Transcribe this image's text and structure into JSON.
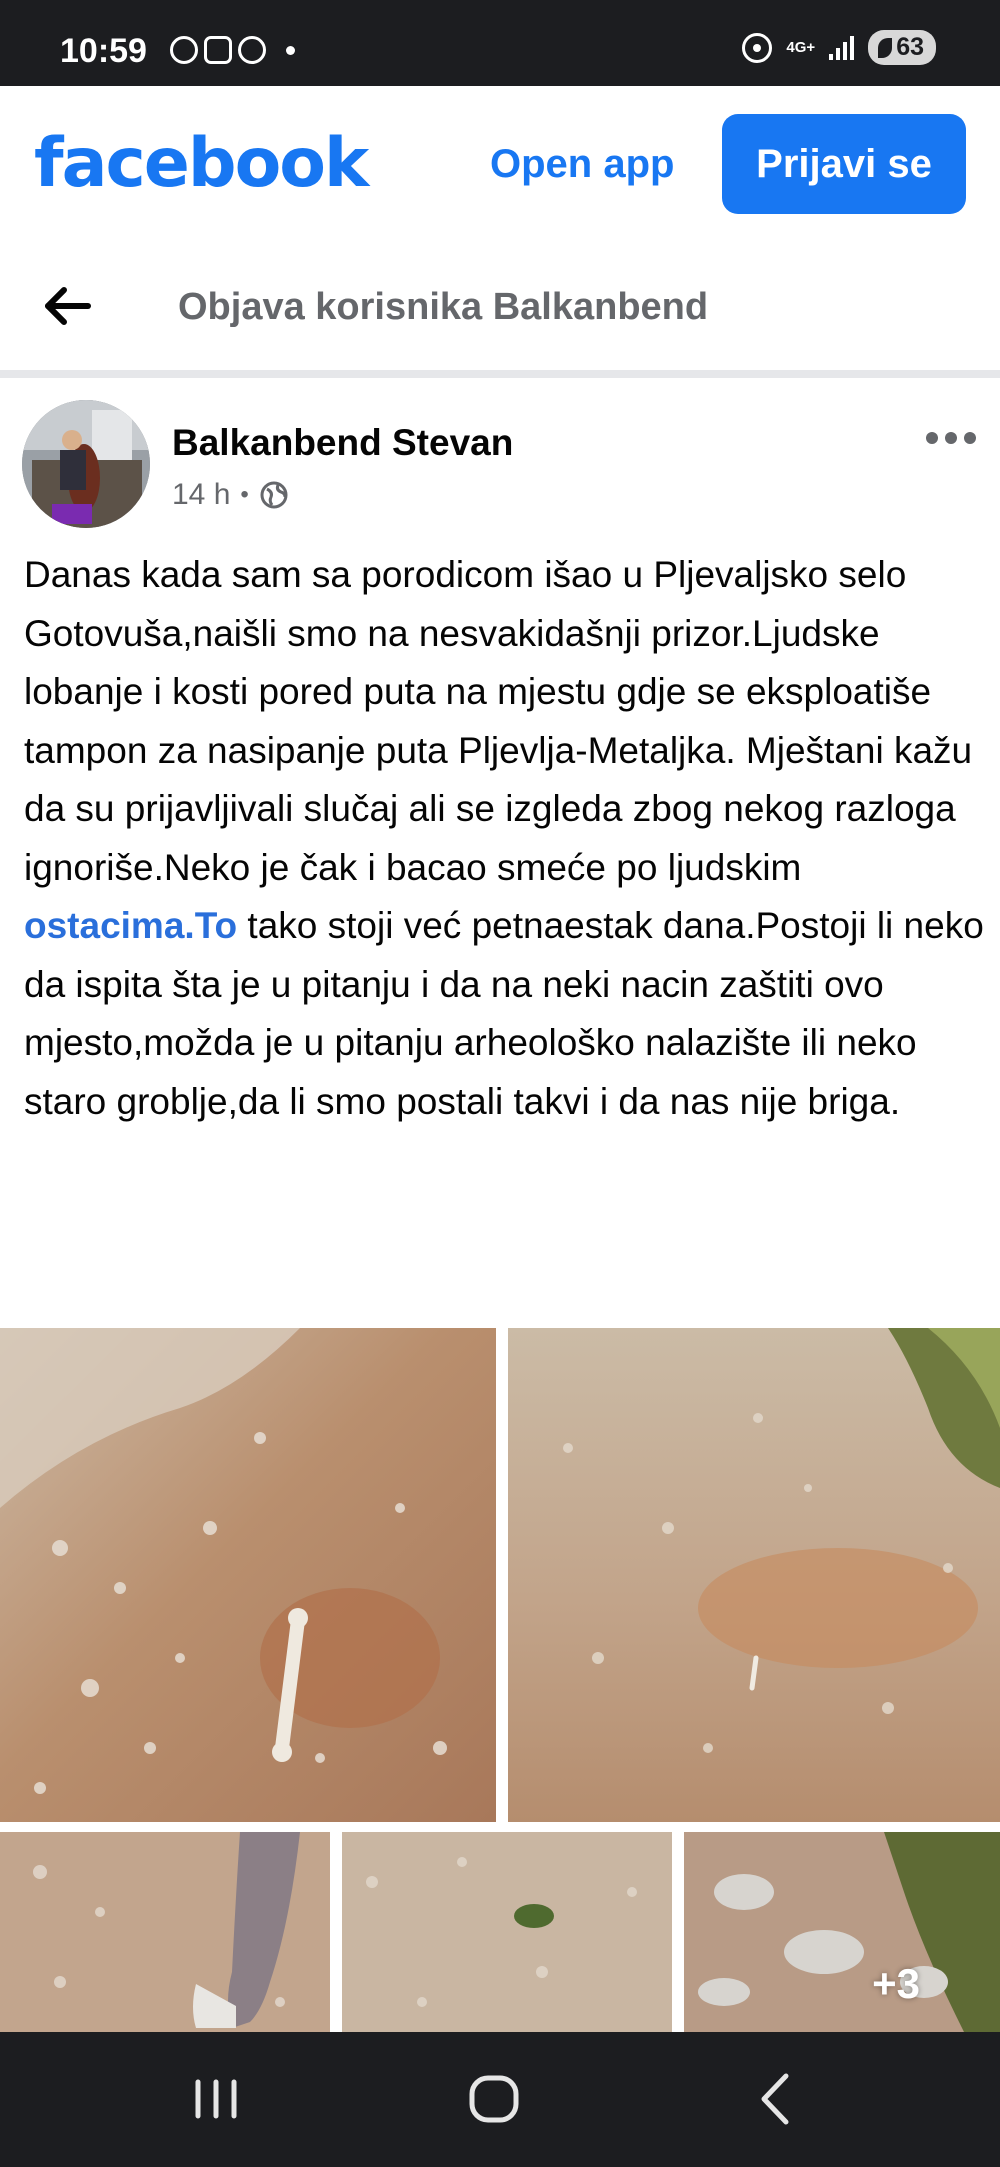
{
  "status_bar": {
    "time": "10:59",
    "network": "4G+",
    "battery": "63",
    "icons": [
      "whatsapp-icon",
      "screenshot-icon",
      "viber-icon",
      "notification-dot",
      "hotspot-icon",
      "signal-icon",
      "battery-saver-icon"
    ]
  },
  "header": {
    "logo": "facebook",
    "open_app": "Open app",
    "login": "Prijavi se",
    "brand_color": "#1877f2"
  },
  "title_bar": {
    "back_icon": "back-arrow-icon",
    "title": "Objava korisnika Balkanbend"
  },
  "post": {
    "author": "Balkanbend Stevan",
    "time": "14 h",
    "separator": "•",
    "audience_icon": "globe-icon",
    "menu_icon": "more-icon",
    "text_before_link": "Danas kada sam sa porodicom išao u Pljevaljsko selo Gotovuša,naišli smo na nesvakidašnji prizor.Ljudske lobanje i kosti pored puta na mjestu gdje se eksploatiše tampon za nasipanje puta Pljevlja-Metaljka. Mještani kažu da su prijavljivali slučaj ali se izgleda zbog nekog razloga ignoriše.Neko je čak i bacao smeće po ljudskim ",
    "link_text": "ostacima.To",
    "text_after_link": " tako stoji već petnaestak dana.Postoji li neko da ispita šta je u pitanju i da na neki nacin zaštiti ovo mjesto,možda je u pitanju arheološko nalazište ili neko staro groblje,da li smo postali takvi i da nas nije briga.",
    "link_color": "#2a6fdb",
    "more_photos": "+3"
  },
  "nav_bar": {
    "recents_icon": "recent-apps-icon",
    "home_icon": "home-icon",
    "back_icon": "nav-back-icon"
  }
}
